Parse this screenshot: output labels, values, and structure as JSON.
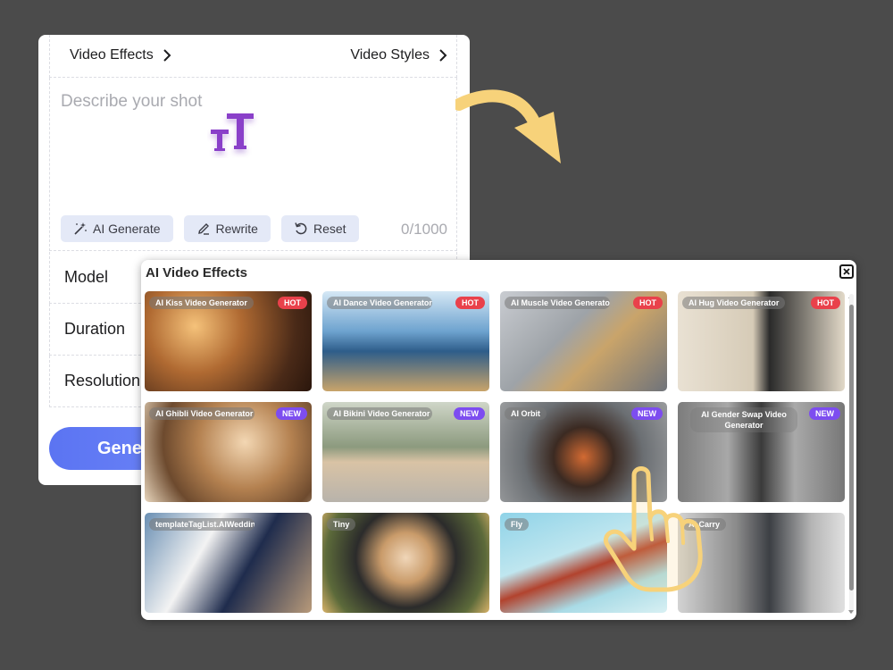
{
  "panel": {
    "tabs": {
      "left_label": "Video Effects",
      "right_label": "Video Styles"
    },
    "prompt": {
      "placeholder": "Describe your shot",
      "counter": "0/1000"
    },
    "tools": {
      "ai_generate": "AI Generate",
      "rewrite": "Rewrite",
      "reset": "Reset"
    },
    "options": {
      "model": "Model",
      "duration": "Duration",
      "resolution": "Resolution"
    },
    "generate_label": "Gene"
  },
  "popup": {
    "title": "AI Video Effects",
    "cards": [
      {
        "label": "AI Kiss Video Generator",
        "badge": "HOT"
      },
      {
        "label": "AI Dance Video Generator",
        "badge": "HOT"
      },
      {
        "label": "AI Muscle Video Generator",
        "badge": "HOT"
      },
      {
        "label": "AI Hug Video Generator",
        "badge": "HOT"
      },
      {
        "label": "AI Ghibli Video Generator",
        "badge": "NEW"
      },
      {
        "label": "AI Bikini Video Generator",
        "badge": "NEW"
      },
      {
        "label": "AI Orbit",
        "badge": "NEW"
      },
      {
        "label": "AI Gender Swap Video Generator",
        "badge": "NEW"
      },
      {
        "label": "templateTagList.AIWedding",
        "badge": ""
      },
      {
        "label": "Tiny",
        "badge": ""
      },
      {
        "label": "Fly",
        "badge": ""
      },
      {
        "label": "AI Carry",
        "badge": ""
      }
    ]
  },
  "colors": {
    "accent": "#5b74f2",
    "hot": "#e9414b",
    "new": "#7d4df0",
    "arrow": "#f7d27a",
    "background": "#4b4b4b"
  }
}
